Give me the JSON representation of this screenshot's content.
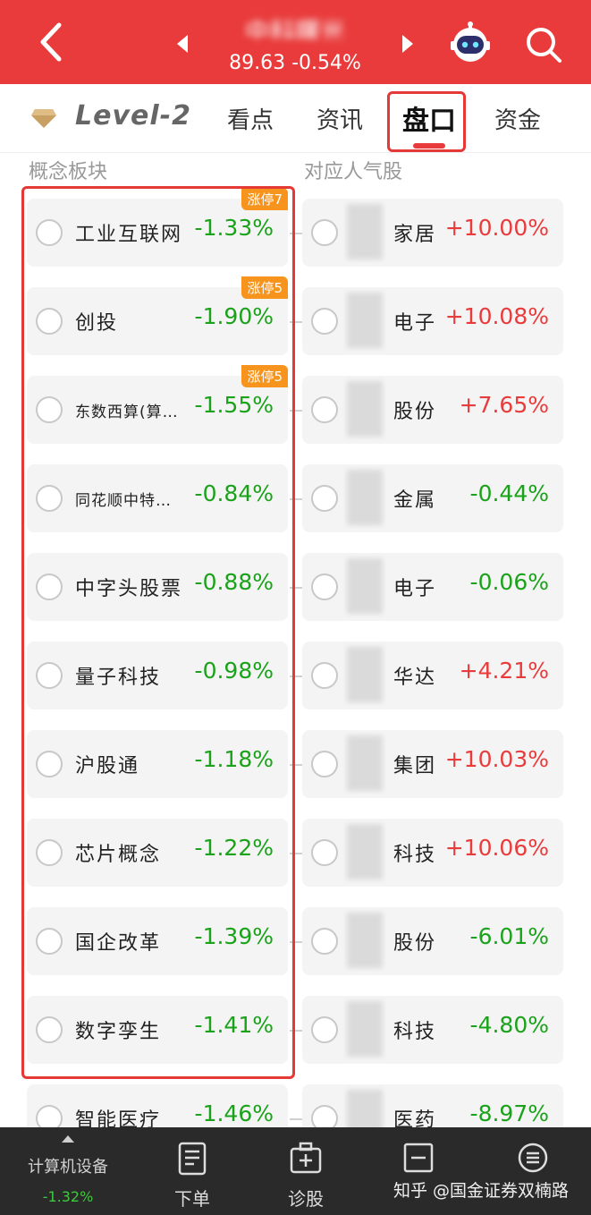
{
  "header": {
    "title": "中科曙光",
    "subtitle": "89.63 -0.54%"
  },
  "tabs": {
    "level": "Level-2",
    "items": [
      "看点",
      "资讯",
      "盘口",
      "资金"
    ]
  },
  "columns": {
    "left": "概念板块",
    "right": "对应人气股"
  },
  "rows": [
    {
      "sector": "工业互联网",
      "sector_pct": "-1.33%",
      "badge": "涨停7",
      "stock": "家居",
      "stock_pct": "+10.00%",
      "stock_dir": "up"
    },
    {
      "sector": "创投",
      "sector_pct": "-1.90%",
      "badge": "涨停5",
      "stock": "电子",
      "stock_pct": "+10.08%",
      "stock_dir": "up"
    },
    {
      "sector": "东数西算(算…",
      "sector_pct": "-1.55%",
      "badge": "涨停5",
      "stock": "股份",
      "stock_pct": "+7.65%",
      "stock_dir": "up"
    },
    {
      "sector": "同花顺中特…",
      "sector_pct": "-0.84%",
      "badge": "",
      "stock": "金属",
      "stock_pct": "-0.44%",
      "stock_dir": "down"
    },
    {
      "sector": "中字头股票",
      "sector_pct": "-0.88%",
      "badge": "",
      "stock": "电子",
      "stock_pct": "-0.06%",
      "stock_dir": "down"
    },
    {
      "sector": "量子科技",
      "sector_pct": "-0.98%",
      "badge": "",
      "stock": "华达",
      "stock_pct": "+4.21%",
      "stock_dir": "up"
    },
    {
      "sector": "沪股通",
      "sector_pct": "-1.18%",
      "badge": "",
      "stock": "集团",
      "stock_pct": "+10.03%",
      "stock_dir": "up"
    },
    {
      "sector": "芯片概念",
      "sector_pct": "-1.22%",
      "badge": "",
      "stock": "科技",
      "stock_pct": "+10.06%",
      "stock_dir": "up"
    },
    {
      "sector": "国企改革",
      "sector_pct": "-1.39%",
      "badge": "",
      "stock": "股份",
      "stock_pct": "-6.01%",
      "stock_dir": "down"
    },
    {
      "sector": "数字孪生",
      "sector_pct": "-1.41%",
      "badge": "",
      "stock": "科技",
      "stock_pct": "-4.80%",
      "stock_dir": "down"
    },
    {
      "sector": "智能医疗",
      "sector_pct": "-1.46%",
      "badge": "",
      "stock": "医药",
      "stock_pct": "-8.97%",
      "stock_dir": "down"
    }
  ],
  "bottom": {
    "sector": "计算机设备",
    "sector_pct": "-1.32%",
    "order": "下单",
    "diagnose": "诊股",
    "watermark": "知乎 @国金证券双楠路"
  },
  "colors": {
    "brand_red": "#e93b3b",
    "up": "#e93b3b",
    "down": "#1aa31a",
    "badge": "#f7941d"
  }
}
